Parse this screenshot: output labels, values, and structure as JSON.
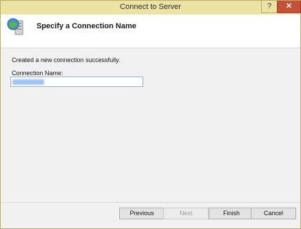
{
  "window": {
    "title": "Connect to Server",
    "help_label": "?",
    "close_label": "✕"
  },
  "header": {
    "title": "Specify a Connection Name",
    "icon": "server-globe-icon"
  },
  "content": {
    "status_message": "Created a new connection successfully.",
    "connection_name_label": "Connection Name:",
    "connection_name_value": ""
  },
  "buttons": {
    "previous": "Previous",
    "next": "Next",
    "finish": "Finish",
    "cancel": "Cancel"
  },
  "colors": {
    "titlebar": "#ece2a3",
    "close_button": "#c7503a",
    "input_border": "#8fb0cf"
  }
}
